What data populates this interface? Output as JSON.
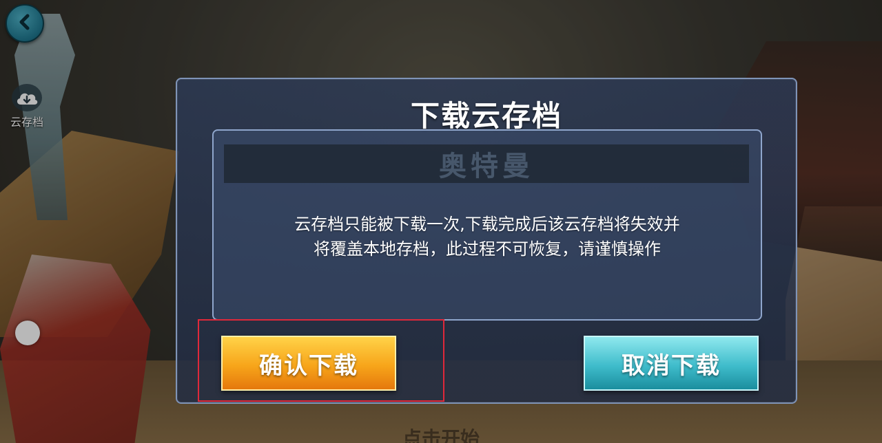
{
  "nav": {
    "back_icon": "chevron-left-icon",
    "cloud_icon": "cloud-download-icon",
    "cloud_label": "云存档"
  },
  "background": {
    "bottom_hint": "点击开始"
  },
  "dialog": {
    "title": "下载云存档",
    "watermark": "奥特曼",
    "message_line1": "云存档只能被下载一次,下载完成后该云存档将失效并",
    "message_line2": "将覆盖本地存档，此过程不可恢复，请谨慎操作",
    "confirm_label": "确认下载",
    "cancel_label": "取消下载"
  },
  "colors": {
    "confirm": "#f7a51a",
    "cancel": "#3fbccb",
    "highlight": "#e0283a",
    "dialog_border": "#7f94b8"
  }
}
